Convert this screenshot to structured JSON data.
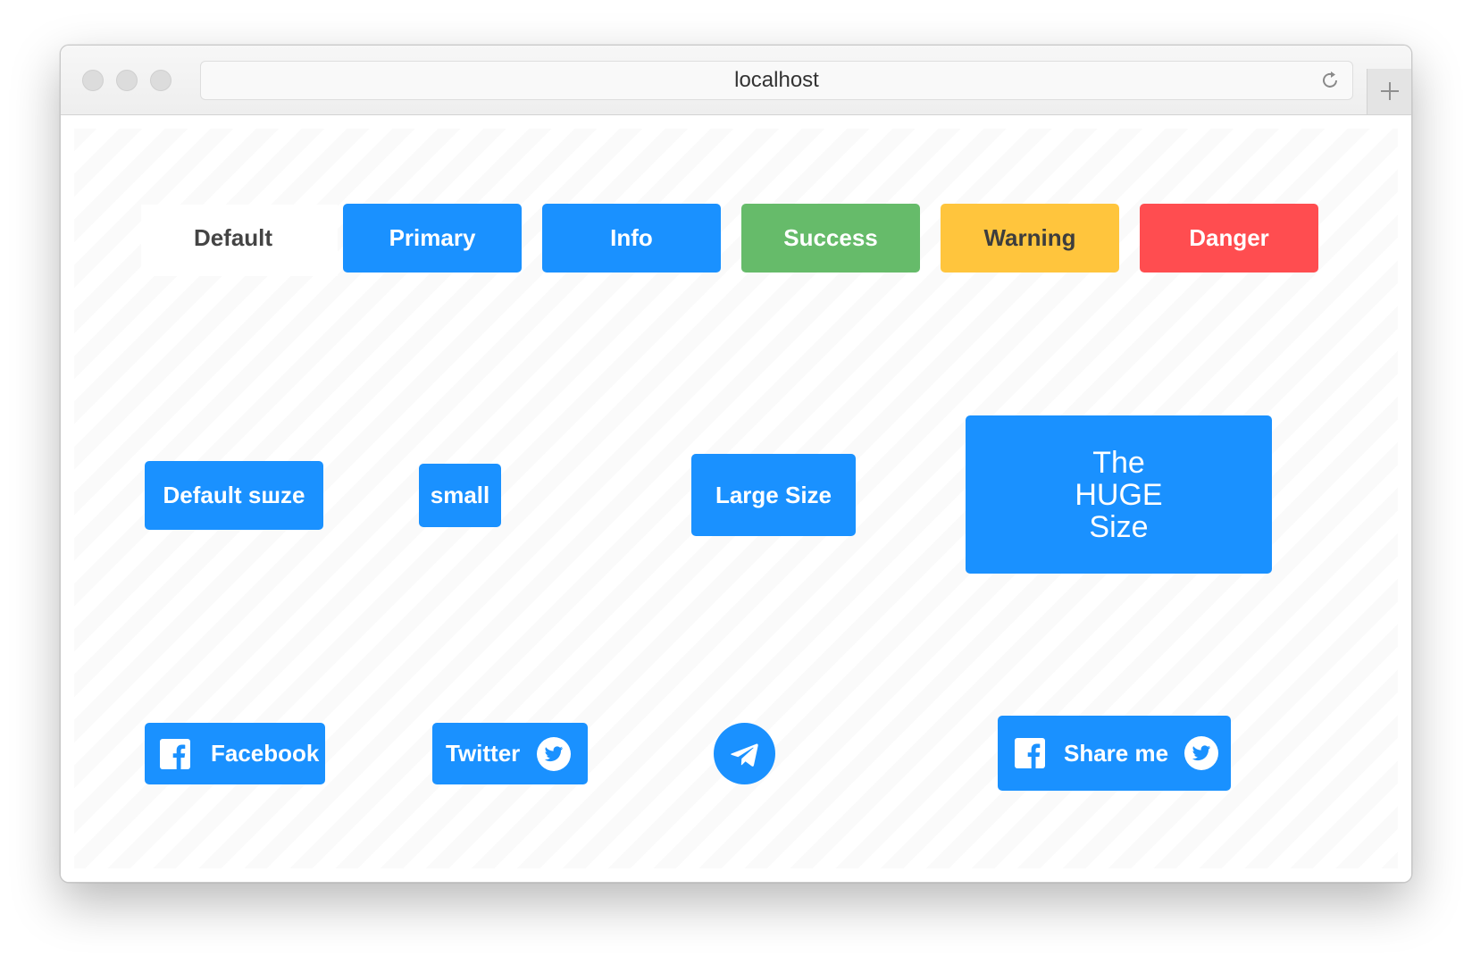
{
  "browser": {
    "url": "localhost"
  },
  "row1": {
    "default": "Default",
    "primary": "Primary",
    "info": "Info",
    "success": "Success",
    "warning": "Warning",
    "danger": "Danger"
  },
  "row2": {
    "default_size": "Default sшze",
    "small": "small",
    "large": "Large Size",
    "huge_line1": "The",
    "huge_line2": "HUGE",
    "huge_line3": "Size"
  },
  "row3": {
    "facebook": "Facebook",
    "twitter": "Twitter",
    "share": "Share me"
  },
  "colors": {
    "primary": "#1a91ff",
    "success": "#66bb6a",
    "warning": "#ffc53d",
    "danger": "#ff4d50"
  },
  "icons": {
    "facebook": "facebook-icon",
    "twitter": "twitter-icon",
    "telegram": "telegram-icon",
    "reload": "reload-icon",
    "new_tab": "plus-icon"
  }
}
